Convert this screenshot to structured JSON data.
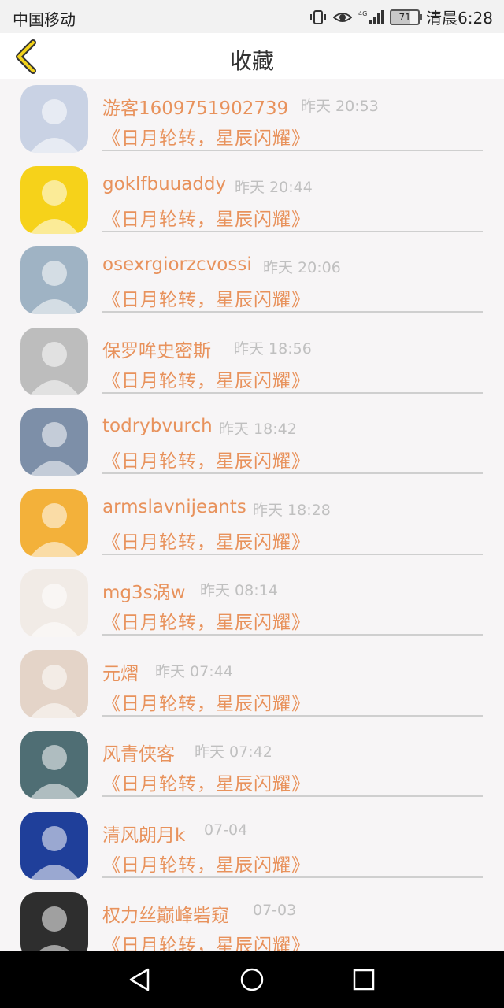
{
  "status_bar": {
    "carrier": "中国移动",
    "battery": "71",
    "time": "清晨6:28",
    "network": "4G"
  },
  "header": {
    "title": "收藏",
    "back_icon": "chevron-left-icon"
  },
  "list": [
    {
      "name": "游客1609751902739",
      "time": "昨天 20:53",
      "subject": "《日月轮转，星辰闪耀》",
      "avatar_color": "#c9d2e4"
    },
    {
      "name": "goklfbuuaddy",
      "time": "昨天 20:44",
      "subject": "《日月轮转，星辰闪耀》",
      "avatar_color": "#f6d21a"
    },
    {
      "name": "osexrgiorzcvossi",
      "time": "昨天 20:06",
      "subject": "《日月轮转，星辰闪耀》",
      "avatar_color": "#9fb3c4"
    },
    {
      "name": "保罗哞史密斯",
      "time": "昨天 18:56",
      "subject": "《日月轮转，星辰闪耀》",
      "avatar_color": "#bdbdbd"
    },
    {
      "name": "todrybvurch",
      "time": "昨天 18:42",
      "subject": "《日月轮转，星辰闪耀》",
      "avatar_color": "#7d8fa8"
    },
    {
      "name": "armslavnijeants",
      "time": "昨天 18:28",
      "subject": "《日月轮转，星辰闪耀》",
      "avatar_color": "#f3b13a"
    },
    {
      "name": "mg3s涡w",
      "time": "昨天 08:14",
      "subject": "《日月轮转，星辰闪耀》",
      "avatar_color": "#f1ebe6"
    },
    {
      "name": "元熠",
      "time": "昨天 07:44",
      "subject": "《日月轮转，星辰闪耀》",
      "avatar_color": "#e4d4c8"
    },
    {
      "name": "风青侠客",
      "time": "昨天 07:42",
      "subject": "《日月轮转，星辰闪耀》",
      "avatar_color": "#4f6e74"
    },
    {
      "name": "清风朗月k",
      "time": "07-04",
      "subject": "《日月轮转，星辰闪耀》",
      "avatar_color": "#1f3f9a"
    },
    {
      "name": "权力丝巅峰砦窥",
      "time": "07-03",
      "subject": "《日月轮转，星辰闪耀》",
      "avatar_color": "#2e2e2e"
    }
  ],
  "nav_bar": {
    "back_icon": "triangle-back-icon",
    "home_icon": "circle-home-icon",
    "recents_icon": "square-recents-icon"
  },
  "colors": {
    "accent": "#e8925c",
    "time_text": "#c0c0c0",
    "back_chevron": "#e6c800"
  }
}
